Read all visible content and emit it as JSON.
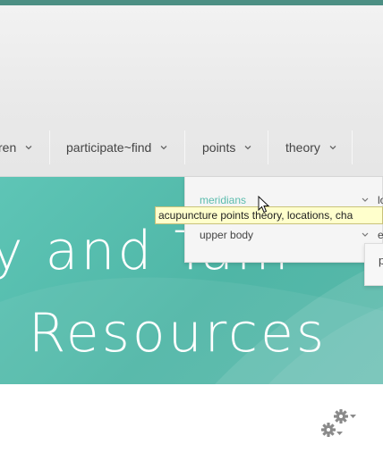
{
  "nav": {
    "items": [
      {
        "label": "ren"
      },
      {
        "label": "participate~find"
      },
      {
        "label": "points"
      },
      {
        "label": "theory"
      }
    ]
  },
  "hero": {
    "line1": "y and Tam",
    "line2": "l Resources"
  },
  "dropdown": {
    "items": [
      {
        "label": "meridians",
        "state": "hover"
      },
      {
        "label": "upper body",
        "state": "normal"
      }
    ],
    "side_labels": [
      "lo",
      "e"
    ]
  },
  "subpanel": {
    "label": "p"
  },
  "tooltip": {
    "text": "acupuncture points theory, locations, cha"
  },
  "colors": {
    "accent": "#5bbcad",
    "hero_bg": "#52b9a9",
    "top_bar": "#4c8f83"
  },
  "icons": {
    "settings": "gear-icon",
    "cursor": "mouse-pointer"
  }
}
